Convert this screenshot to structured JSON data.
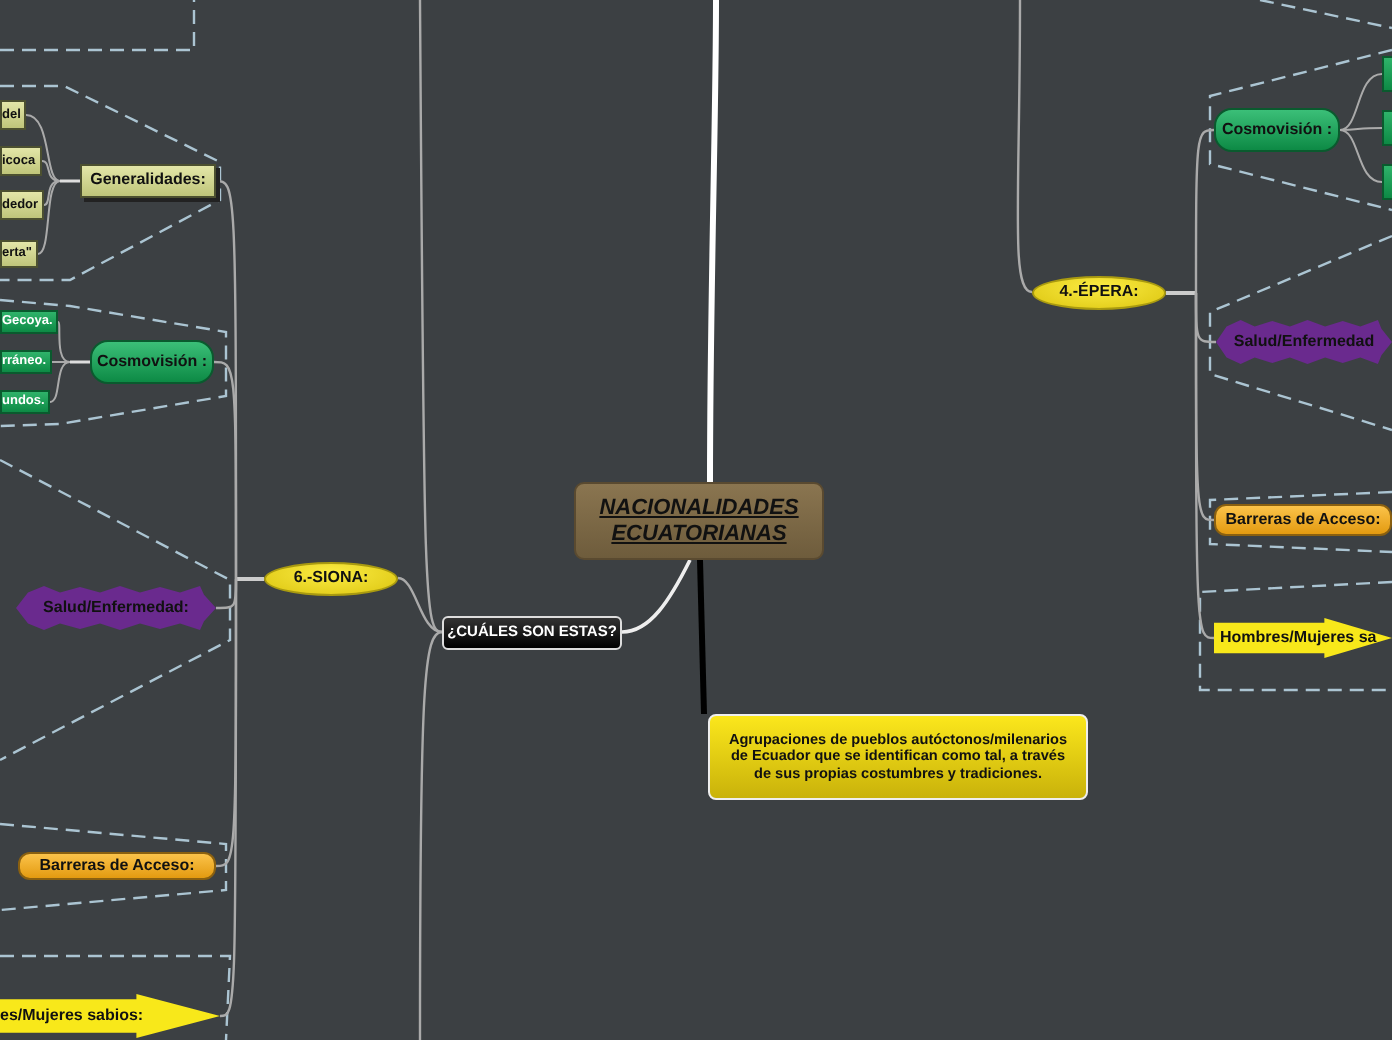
{
  "central_topic": {
    "title": "NACIONALIDADES ECUATORIANAS"
  },
  "description": {
    "text": "Agrupaciones de pueblos autóctonos/milenarios de Ecuador que se identifican como tal, a través de sus propias costumbres y tradiciones."
  },
  "question": {
    "label": "¿CUÁLES SON ESTAS?"
  },
  "nationalities": [
    {
      "label": "6.-SIONA:",
      "branches": [
        {
          "kind": "box",
          "label": "Generalidades:",
          "children": [
            {
              "kind": "olive",
              "label": "del"
            },
            {
              "kind": "olive",
              "label": "icoca"
            },
            {
              "kind": "olive",
              "label": "dedor"
            },
            {
              "kind": "olive",
              "label": "erta\""
            }
          ]
        },
        {
          "kind": "capsule",
          "label": "Cosmovisión :",
          "children": [
            {
              "kind": "green",
              "label": "Gecoya."
            },
            {
              "kind": "green",
              "label": "rráneo."
            },
            {
              "kind": "green",
              "label": "undos."
            }
          ]
        },
        {
          "kind": "burst",
          "label": "Salud/Enfermedad:"
        },
        {
          "kind": "bar",
          "label": "Barreras de Acceso:"
        },
        {
          "kind": "arrow",
          "label": "es/Mujeres sabios:"
        }
      ]
    },
    {
      "label": "4.-ÉPERA:",
      "branches": [
        {
          "kind": "capsule",
          "label": "Cosmovisión :",
          "children": [
            {
              "kind": "green"
            },
            {
              "kind": "green"
            },
            {
              "kind": "green"
            }
          ]
        },
        {
          "kind": "burst",
          "label": "Salud/Enfermedad"
        },
        {
          "kind": "bar",
          "label": "Barreras de Acceso:"
        },
        {
          "kind": "arrow",
          "label": "Hombres/Mujeres sa"
        }
      ]
    }
  ]
}
